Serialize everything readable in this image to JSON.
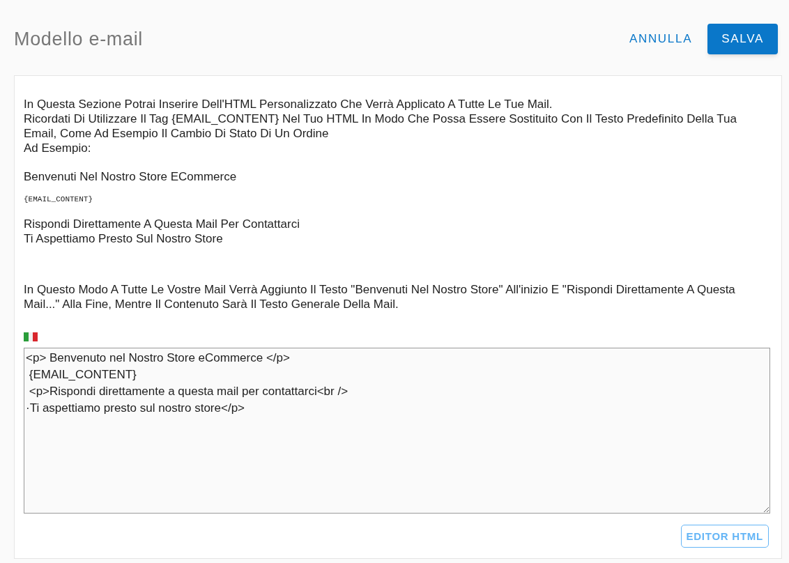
{
  "header": {
    "title": "Modello e-mail",
    "buttons": [
      {
        "label": "ANNULLA",
        "kind": "text"
      },
      {
        "label": "SALVA",
        "kind": "filled"
      }
    ]
  },
  "intro": [
    "In Questa Sezione Potrai Inserire Dell'HTML Personalizzato Che Verrà Applicato A Tutte Le Tue Mail.",
    "Ricordati Di Utilizzare Il Tag {EMAIL_CONTENT} Nel Tuo HTML In Modo Che Possa Essere Sostituito Con Il Testo Predefinito Della Tua Email, Come Ad Esempio Il Cambio Di Stato Di Un Ordine",
    "Ad Esempio:"
  ],
  "example": {
    "heading": "Benvenuti Nel Nostro Store ECommerce",
    "tag": "{EMAIL_CONTENT}",
    "footer": [
      "Rispondi Direttamente A Questa Mail Per Contattarci",
      "Ti Aspettiamo Presto Sul Nostro Store"
    ]
  },
  "explanation": "In Questo Modo A Tutte Le Vostre Mail Verrà Aggiunto Il Testo \"Benvenuti Nel Nostro Store\" All'inizio E \"Rispondi Direttamente A Questa Mail...\" Alla Fine, Mentre Il Contenuto Sarà Il Testo Generale Della Mail.",
  "editor": {
    "value": "<p> Benvenuto nel Nostro Store eCommerce </p>\n {EMAIL_CONTENT}\n <p>Rispondi direttamente a questa mail per contattarci<br />\n·Ti aspettiamo presto sul nostro store</p>"
  },
  "editor_button": "EDITOR HTML"
}
